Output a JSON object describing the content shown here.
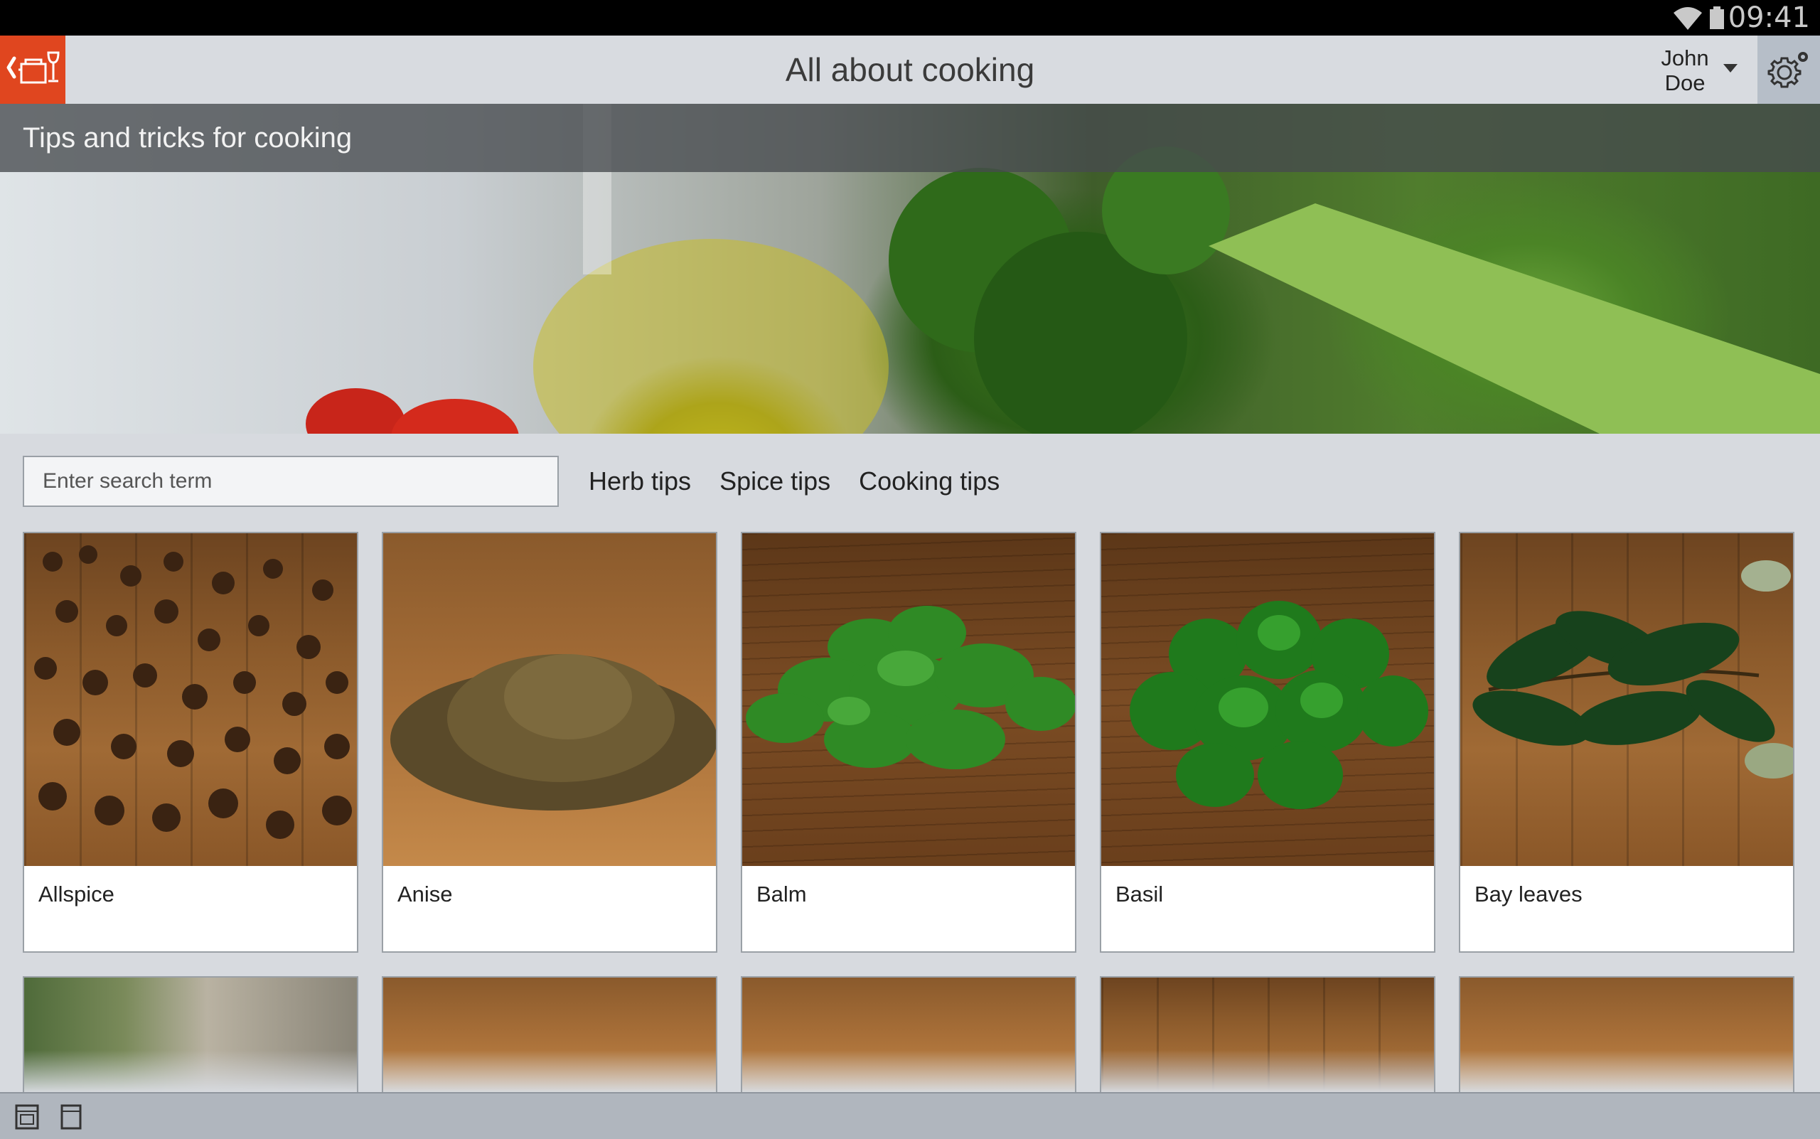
{
  "status_bar": {
    "time": "09:41",
    "wifi_icon": "wifi-icon",
    "battery_icon": "battery-icon"
  },
  "header": {
    "title": "All about cooking",
    "back_icon": "back-cooking-pot-icon",
    "user": {
      "first": "John",
      "last": "Doe"
    },
    "settings_icon": "gear-icon"
  },
  "hero": {
    "subtitle": "Tips and tricks for cooking"
  },
  "search": {
    "placeholder": "Enter search term",
    "value": ""
  },
  "filters": [
    {
      "label": "Herb tips"
    },
    {
      "label": "Spice tips"
    },
    {
      "label": "Cooking tips"
    }
  ],
  "cards": [
    {
      "label": "Allspice"
    },
    {
      "label": "Anise"
    },
    {
      "label": "Balm"
    },
    {
      "label": "Basil"
    },
    {
      "label": "Bay leaves"
    }
  ],
  "colors": {
    "accent": "#e0461f",
    "background": "#d7dadf",
    "header": "#d8dbe0"
  }
}
